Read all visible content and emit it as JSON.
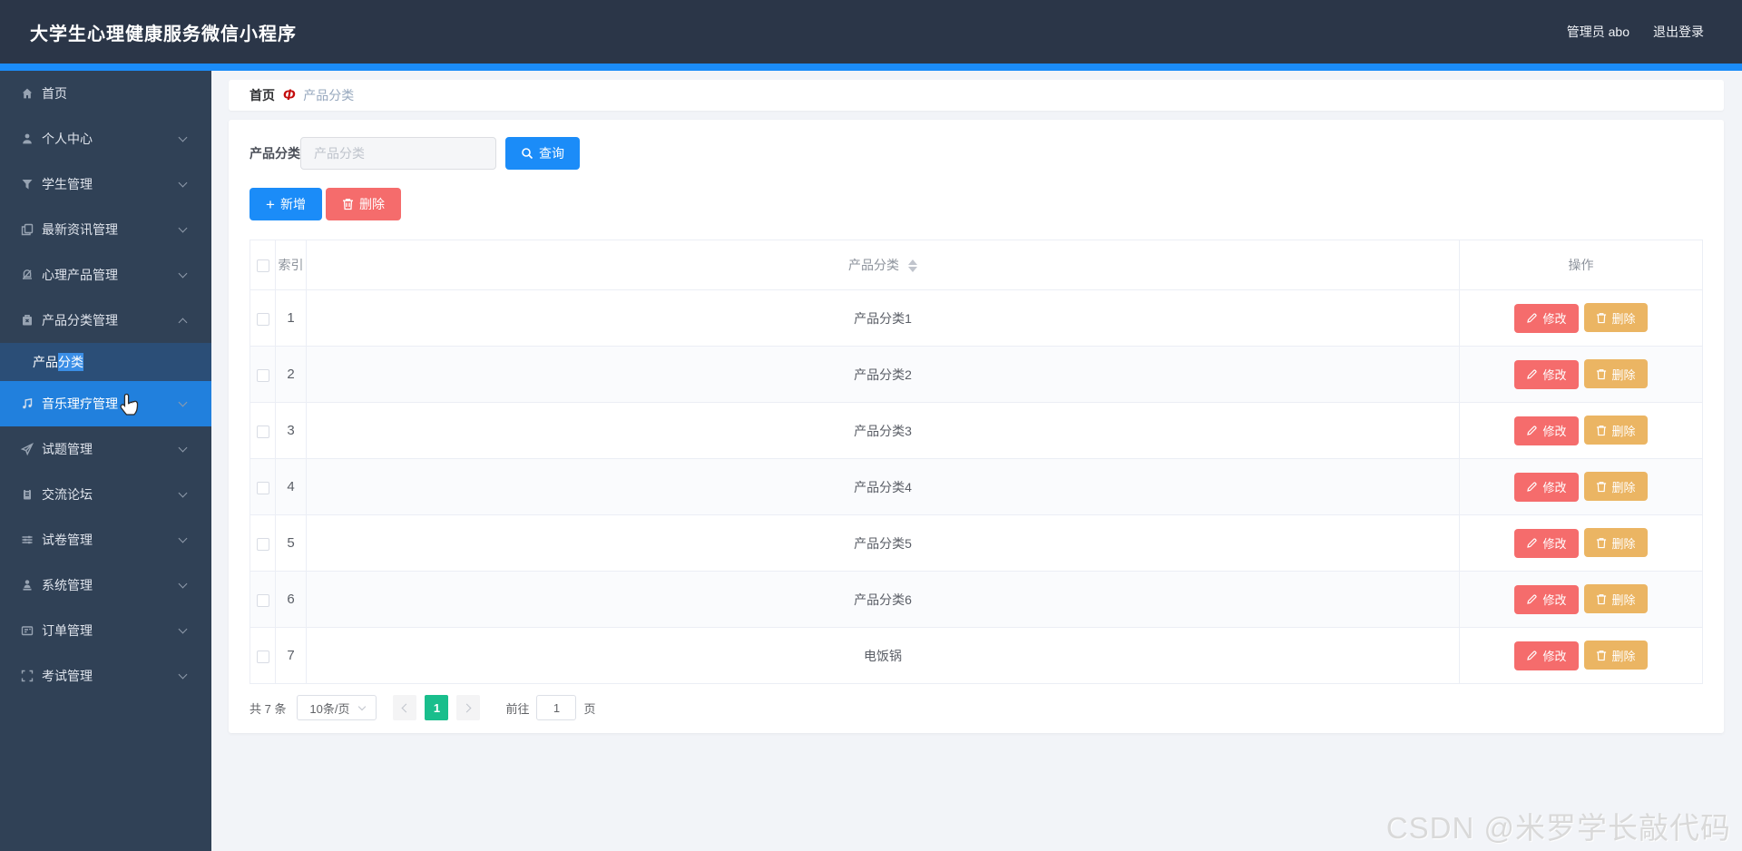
{
  "header": {
    "title": "大学生心理健康服务微信小程序",
    "admin": "管理员 abo",
    "logout": "退出登录"
  },
  "sidebar": {
    "items": [
      {
        "label": "首页",
        "icon": "home-icon"
      },
      {
        "label": "个人中心",
        "icon": "user-icon"
      },
      {
        "label": "学生管理",
        "icon": "filter-icon"
      },
      {
        "label": "最新资讯管理",
        "icon": "documents-icon"
      },
      {
        "label": "心理产品管理",
        "icon": "bell-icon"
      },
      {
        "label": "产品分类管理",
        "icon": "box-icon",
        "expanded": true
      },
      {
        "label": "音乐理疗管理",
        "icon": "music-icon",
        "hovered": true
      },
      {
        "label": "试题管理",
        "icon": "send-icon"
      },
      {
        "label": "交流论坛",
        "icon": "clipboard-icon"
      },
      {
        "label": "试卷管理",
        "icon": "sliders-icon"
      },
      {
        "label": "系统管理",
        "icon": "person-icon"
      },
      {
        "label": "订单管理",
        "icon": "postcard-icon"
      },
      {
        "label": "考试管理",
        "icon": "fullscreen-icon"
      }
    ],
    "submenu": {
      "label": "产品分类",
      "prefix": "产品",
      "selected": "分类"
    }
  },
  "breadcrumb": {
    "home": "首页",
    "separator": "Ф",
    "current": "产品分类"
  },
  "search": {
    "label": "产品分类",
    "placeholder": "产品分类",
    "query": "查询"
  },
  "toolbar": {
    "add": "新增",
    "delete": "删除"
  },
  "table": {
    "headers": {
      "index": "索引",
      "category": "产品分类",
      "actions": "操作"
    },
    "rows": [
      {
        "index": "1",
        "category": "产品分类1"
      },
      {
        "index": "2",
        "category": "产品分类2"
      },
      {
        "index": "3",
        "category": "产品分类3"
      },
      {
        "index": "4",
        "category": "产品分类4"
      },
      {
        "index": "5",
        "category": "产品分类5"
      },
      {
        "index": "6",
        "category": "产品分类6"
      },
      {
        "index": "7",
        "category": "电饭锅"
      }
    ],
    "actions": {
      "edit": "修改",
      "delete": "删除"
    }
  },
  "pagination": {
    "total": "共 7 条",
    "size": "10条/页",
    "page": "1",
    "goto": "前往",
    "goto_value": "1",
    "unit": "页"
  },
  "watermark": "CSDN @米罗学长敲代码",
  "colors": {
    "header_bg": "#2b3648",
    "sidebar_bg": "#304156",
    "accent_blue": "#1b8cf8",
    "hover_blue": "#2180dd",
    "submenu_bg": "#2b4e77",
    "danger_red": "#f56c6c",
    "warning_yellow": "#ebb563",
    "page_green": "#19be8c"
  }
}
